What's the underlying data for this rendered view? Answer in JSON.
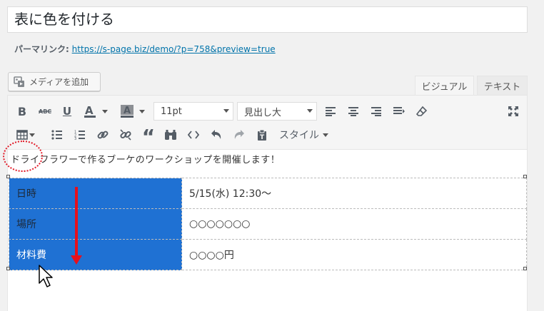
{
  "post": {
    "title": "表に色を付ける",
    "permalink_label": "パーマリンク:",
    "permalink_url": "https://s-page.biz/demo/?p=758&preview=true"
  },
  "media": {
    "add_media_label": "メディアを追加",
    "icon": "add-media-icon"
  },
  "tabs": {
    "visual": "ビジュアル",
    "text": "テキスト",
    "active": "visual"
  },
  "toolbar": {
    "font_size": "11pt",
    "block_format": "見出し大",
    "style_menu": "スタイル",
    "row1_icons": [
      "bold-icon",
      "strikethrough-icon",
      "underline-icon",
      "text-color-icon",
      "background-color-icon",
      "align-left-icon",
      "align-center-icon",
      "align-right-icon",
      "justify-icon",
      "clear-formatting-icon",
      "fullscreen-icon"
    ],
    "row2_icons": [
      "table-icon",
      "bullet-list-icon",
      "numbered-list-icon",
      "insert-link-icon",
      "remove-link-icon",
      "blockquote-icon",
      "find-replace-icon",
      "code-icon",
      "undo-icon",
      "redo-icon",
      "paste-text-icon"
    ]
  },
  "content": {
    "intro": "ドライフラワーで作るブーケのワークショップを開催します！",
    "table": {
      "rows": [
        {
          "head": "日時",
          "value": "5/15(水) 12:30〜"
        },
        {
          "head": "場所",
          "value": "○○○○○○○"
        },
        {
          "head": "材料費",
          "value": "○○○○円"
        }
      ],
      "head_color": "#1f71d3"
    }
  },
  "annotations": {
    "circle_color": "#e21d2a",
    "arrow_color": "#e6101c",
    "arrow_direction": "down"
  }
}
